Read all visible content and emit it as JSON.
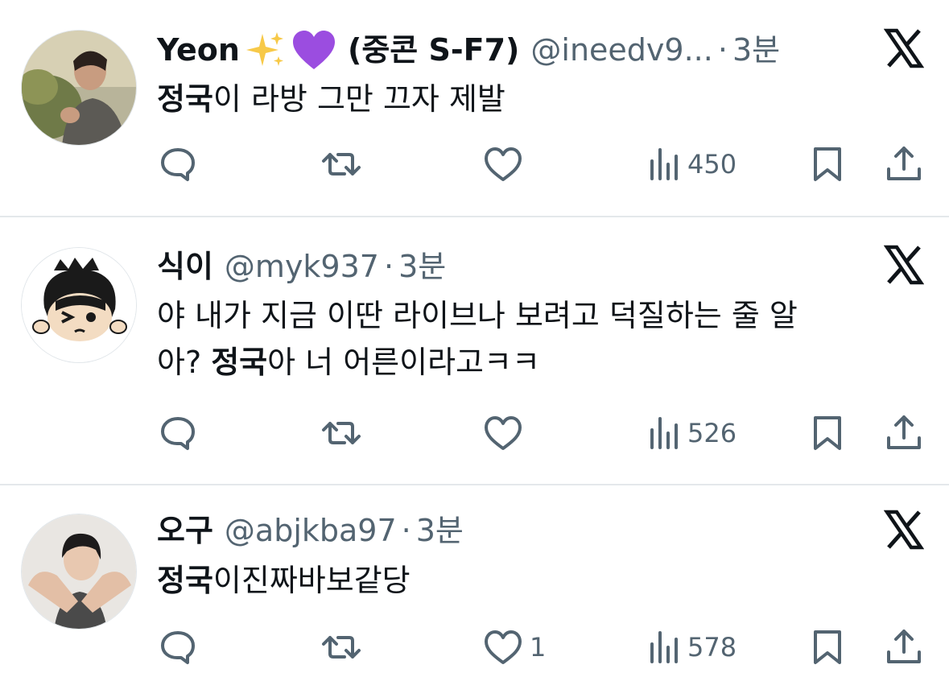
{
  "tweets": [
    {
      "name": "Yeon",
      "name_suffix": "(중콘 S-F7)",
      "emojis": [
        "sparkles",
        "purple-heart"
      ],
      "handle": "@ineedv9...",
      "sep": "·",
      "time": "3분",
      "text_bold": "정국",
      "text_rest": "이 라방 그만 끄자 제발",
      "likes": "",
      "views": "450"
    },
    {
      "name": "식이",
      "handle": "@myk937",
      "sep": "·",
      "time": "3분",
      "line1": "야 내가 지금 이딴 라이브나 보려고 덕질하는 줄 알",
      "line2_pre": "아? ",
      "line2_bold": "정국",
      "line2_rest": "아 너 어른이라고ㅋㅋ",
      "likes": "",
      "views": "526"
    },
    {
      "name": "오구",
      "handle": "@abjkba97",
      "sep": "·",
      "time": "3분",
      "text_bold": "정국",
      "text_rest": "이진짜바보같당",
      "likes": "1",
      "views": "578"
    }
  ],
  "icons": {
    "reply": "reply-icon",
    "retweet": "retweet-icon",
    "like": "heart-icon",
    "views": "views-icon",
    "bookmark": "bookmark-icon",
    "share": "share-icon",
    "platform": "x-logo-icon"
  },
  "colors": {
    "text": "#0f1419",
    "muted": "#536471",
    "divider": "#e4e8eb"
  }
}
